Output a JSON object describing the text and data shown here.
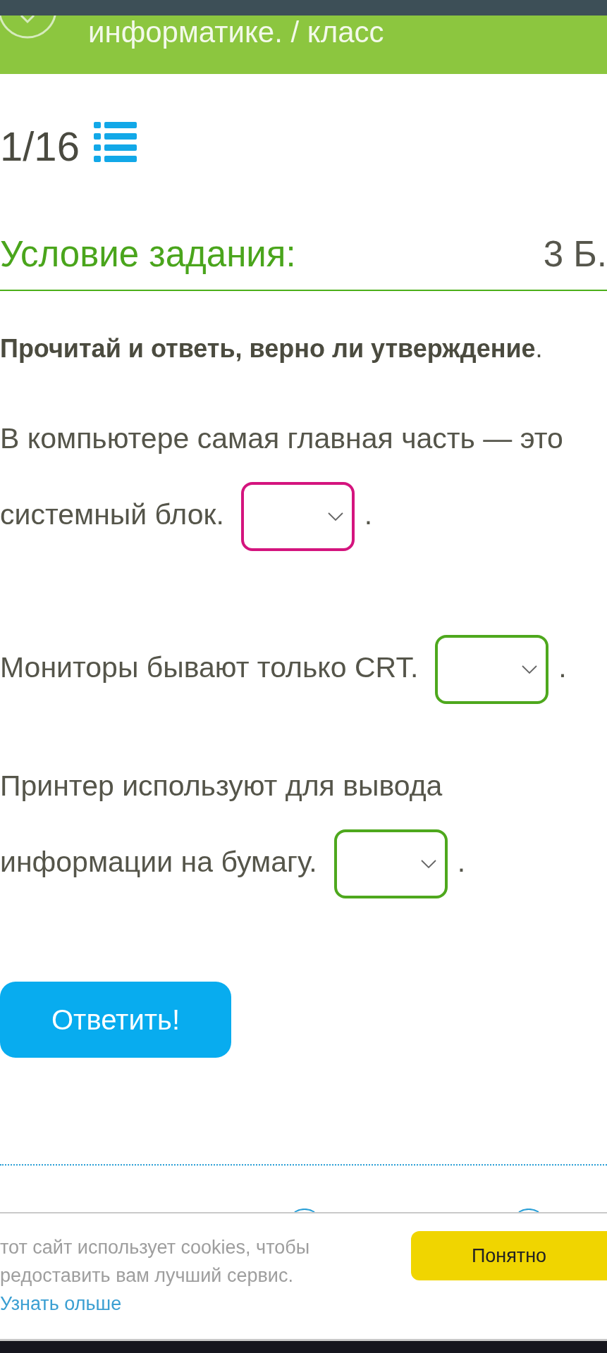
{
  "header": {
    "title": "информатике. / класс"
  },
  "progress": {
    "counter": "1/16"
  },
  "task": {
    "heading": "Условие задания:",
    "points": "3 Б.",
    "instruction": "**Прочитай и ответь, верно ли утверждение**.",
    "statements": [
      {
        "text": "В компьютере самая главная часть — это системный блок.",
        "dropdown": {
          "focused": true
        },
        "after": "."
      },
      {
        "text": "Мониторы бывают только CRT.",
        "dropdown": {
          "focused": false
        },
        "after": "."
      },
      {
        "text": "Принтер используют для вывода информации на бумагу.",
        "dropdown": {
          "focused": false
        },
        "after": "."
      }
    ]
  },
  "submit_button": "Ответить!",
  "cookie_banner": {
    "text": "тот сайт использует cookies, чтобы редоставить вам лучший сервис.",
    "link": "Узнать ольше",
    "button": "Понятно"
  }
}
